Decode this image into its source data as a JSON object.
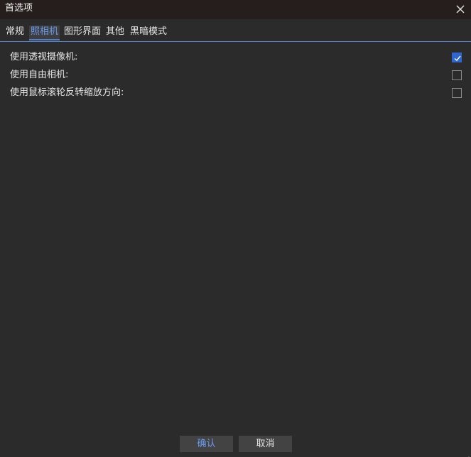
{
  "window": {
    "title": "首选项"
  },
  "tabs": [
    {
      "label": "常规",
      "active": false
    },
    {
      "label": "照相机",
      "active": true
    },
    {
      "label": "图形界面",
      "active": false
    },
    {
      "label": "其他",
      "active": false
    },
    {
      "label": "黑暗模式",
      "active": false
    }
  ],
  "options": [
    {
      "label": "使用透视摄像机:",
      "checked": true
    },
    {
      "label": "使用自由相机:",
      "checked": false
    },
    {
      "label": "使用鼠标滚轮反转缩放方向:",
      "checked": false
    }
  ],
  "buttons": {
    "ok_label": "确认",
    "cancel_label": "取消"
  },
  "colors": {
    "accent": "#4f7fd0",
    "background": "#2b2b2b",
    "titlebar": "#261e1c"
  },
  "icons": {
    "close": "close-icon",
    "check": "check-icon",
    "resize": "resize-grip-icon"
  }
}
